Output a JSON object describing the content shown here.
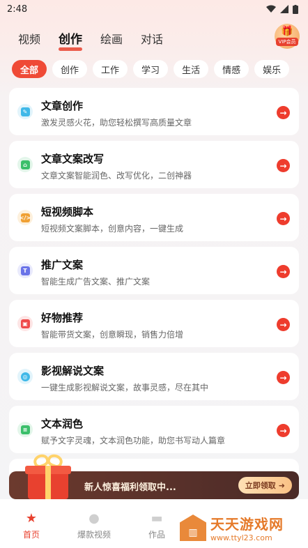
{
  "status_bar": {
    "time": "2:48"
  },
  "top_tabs": [
    {
      "label": "视频",
      "active": false
    },
    {
      "label": "创作",
      "active": true
    },
    {
      "label": "绘画",
      "active": false
    },
    {
      "label": "对话",
      "active": false
    }
  ],
  "vip": {
    "label": "VIP会员"
  },
  "categories": [
    {
      "label": "全部",
      "active": true
    },
    {
      "label": "创作",
      "active": false
    },
    {
      "label": "工作",
      "active": false
    },
    {
      "label": "学习",
      "active": false
    },
    {
      "label": "生活",
      "active": false
    },
    {
      "label": "情感",
      "active": false
    },
    {
      "label": "娱乐",
      "active": false
    }
  ],
  "cards": [
    {
      "title": "文章创作",
      "desc": "激发灵感火花，助您轻松撰写高质量文章",
      "icon": "pen-icon",
      "color": "#3fb8e8"
    },
    {
      "title": "文章文案改写",
      "desc": "文章文案智能润色、改写优化，二创神器",
      "icon": "house-edit-icon",
      "color": "#3bbf6a"
    },
    {
      "title": "短视频脚本",
      "desc": "短视频文案脚本，创意内容，一键生成",
      "icon": "code-icon",
      "color": "#f0a033"
    },
    {
      "title": "推广文案",
      "desc": "智能生成广告文案、推广文案",
      "icon": "text-t-icon",
      "color": "#6a73e8"
    },
    {
      "title": "好物推荐",
      "desc": "智能带货文案，创意瞬现，销售力倍增",
      "icon": "shopping-bag-icon",
      "color": "#ef4a4a"
    },
    {
      "title": "影视解说文案",
      "desc": "一键生成影视解说文案，故事灵感，尽在其中",
      "icon": "film-reel-icon",
      "color": "#3fb8e8"
    },
    {
      "title": "文本润色",
      "desc": "赋予文字灵魂，文本润色功能，助您书写动人篇章",
      "icon": "document-icon",
      "color": "#3bbf6a"
    }
  ],
  "promo": {
    "text": "新人惊喜福利领取中...",
    "button": "立即领取"
  },
  "bottom_nav": [
    {
      "label": "首页",
      "active": true,
      "icon": "home-star-icon"
    },
    {
      "label": "爆款视频",
      "active": false,
      "icon": "flame-icon"
    },
    {
      "label": "作品",
      "active": false,
      "icon": "folder-icon"
    }
  ],
  "watermark": {
    "title": "天天游戏网",
    "url": "www.ttyl23.com"
  }
}
